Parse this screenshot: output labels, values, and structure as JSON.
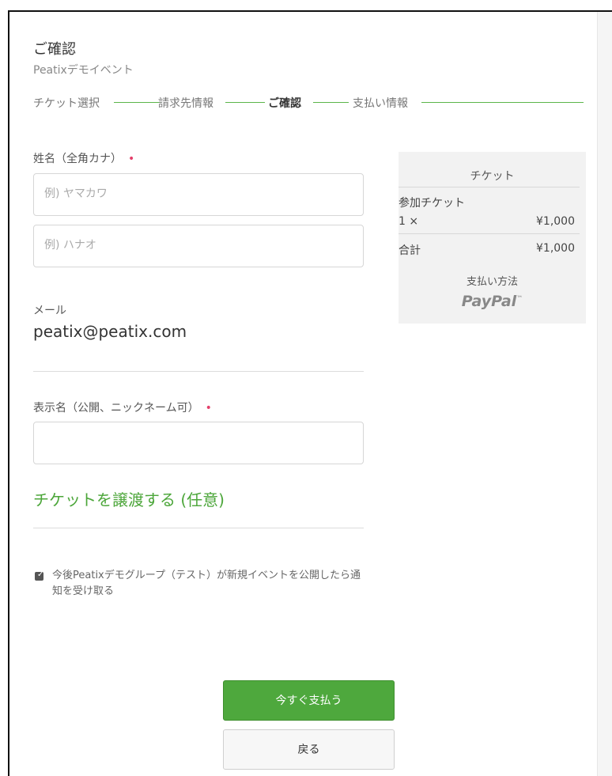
{
  "header": {
    "title": "ご確認",
    "event_name": "Peatixデモイベント"
  },
  "steps": [
    {
      "label": "チケット選択",
      "active": false
    },
    {
      "label": "請求先情報",
      "active": false
    },
    {
      "label": "ご確認",
      "active": true
    },
    {
      "label": "支払い情報",
      "active": false
    }
  ],
  "form": {
    "name_label": "姓名（全角カナ）",
    "required_mark": "•",
    "last_name_placeholder": "例) ヤマカワ",
    "first_name_placeholder": "例) ハナオ",
    "email_label": "メール",
    "email_value": "peatix@peatix.com",
    "display_name_label": "表示名（公開、ニックネーム可）",
    "display_name_value": "",
    "transfer_link": "チケットを譲渡する (任意)",
    "notify_checked": true,
    "notify_text": "今後Peatixデモグループ（テスト）が新規イベントを公開したら通知を受け取る"
  },
  "buttons": {
    "pay": "今すぐ支払う",
    "back": "戻る"
  },
  "summary": {
    "title": "チケット",
    "ticket_name": "参加チケット",
    "qty": "1 ×",
    "price": "¥1,000",
    "total_label": "合計",
    "total_value": "¥1,000",
    "payment_method_label": "支払い方法",
    "payment_method": "PayPal",
    "payment_tm": "™"
  },
  "colors": {
    "accent_green": "#4ea83d",
    "required_red": "#e4406b"
  }
}
